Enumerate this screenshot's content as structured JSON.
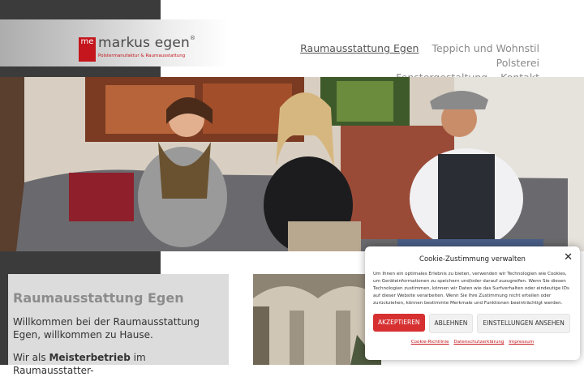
{
  "logo": {
    "mark": "me",
    "name": "markus egen",
    "reg": "®",
    "tagline": "Polstermanufaktur & Raumausstattung"
  },
  "nav": {
    "items": [
      {
        "label": "Raumausstattung Egen",
        "active": true
      },
      {
        "label": "Teppich und Wohnstil",
        "active": false
      },
      {
        "label": "Polsterei",
        "active": false
      },
      {
        "label": "Fenstergestaltung",
        "active": false
      },
      {
        "label": "Kontakt",
        "active": false
      }
    ]
  },
  "intro": {
    "title": "Raumausstattung Egen",
    "p1": "Willkommen bei der Raumausstattung Egen, willkommen zu Hause.",
    "p2_prefix": "Wir als ",
    "p2_bold": "Meisterbetrieb",
    "p2_suffix": " im Raumausstatter-"
  },
  "cookie": {
    "title": "Cookie-Zustimmung verwalten",
    "close": "✕",
    "body": "Um Ihnen ein optimales Erlebnis zu bieten, verwenden wir Technologien wie Cookies, um Geräteinformationen zu speichern und/oder darauf zuzugreifen. Wenn Sie diesen Technologien zustimmen, können wir Daten wie das Surfverhalten oder eindeutige IDs auf dieser Website verarbeiten. Wenn Sie Ihre Zustimmung nicht erteilen oder zurückziehen, können bestimmte Merkmale und Funktionen beeinträchtigt werden.",
    "accept": "AKZEPTIEREN",
    "decline": "ABLEHNEN",
    "settings": "EINSTELLUNGEN ANSEHEN",
    "links": [
      "Cookie-Richtlinie",
      "Datenschutzerklärung",
      "Impressum"
    ]
  },
  "colors": {
    "accent": "#c4161c",
    "dark": "#3b3b3b",
    "accept_button": "#d63031"
  }
}
